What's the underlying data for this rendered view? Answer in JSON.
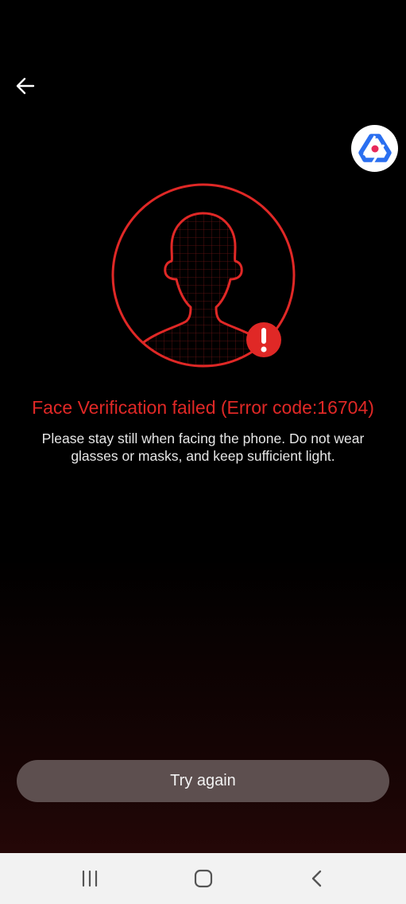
{
  "error": {
    "title": "Face Verification failed (Error code:16704)",
    "description": "Please stay still when facing the phone. Do not wear glasses or masks, and keep sufficient light."
  },
  "actions": {
    "try_again_label": "Try again"
  },
  "icons": {
    "back": "arrow-left-icon",
    "logo": "app-logo-icon",
    "face": "face-silhouette-icon",
    "alert": "exclamation-icon",
    "recents": "recents-icon",
    "home": "home-icon",
    "nav_back": "chevron-left-icon"
  },
  "colors": {
    "accent": "#e02826",
    "button": "#5d4f4f",
    "logo_blue": "#2a6ff0",
    "logo_pink": "#e8285a",
    "nav_bg": "#f2f2f2"
  }
}
